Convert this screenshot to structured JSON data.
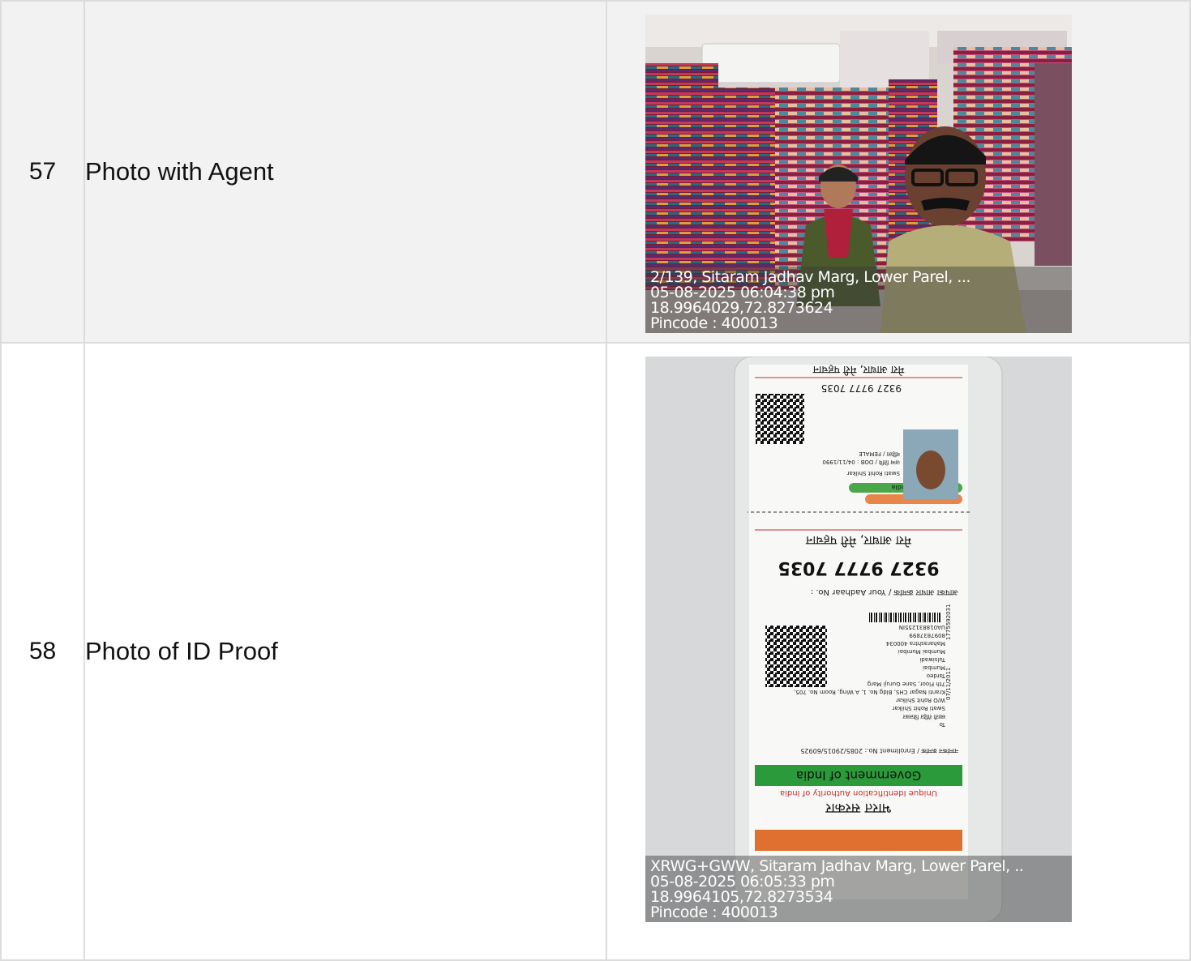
{
  "rows": [
    {
      "number": "57",
      "label": "Photo with Agent",
      "photo": {
        "subject": "selfie-in-textile-shop",
        "stamp": {
          "address": "2/139, Sitaram Jadhav Marg, Lower Parel, ...",
          "datetime": "05-08-2025 06:04:38 pm",
          "coords": "18.9964029,72.8273624",
          "pincode": "Pincode : 400013"
        }
      }
    },
    {
      "number": "58",
      "label": "Photo of ID Proof",
      "photo": {
        "subject": "aadhaar-card-in-plastic-sleeve",
        "card_text": {
          "tagline": "मेरा आधार, मेरी पहचान",
          "aadhaar_number": "9327 9777 7035",
          "aadhaar_label": "आपका आधार क्रमांक / Your Aadhaar No. :",
          "govt_hindi": "भारत सरकार",
          "govt_english": "Government of India",
          "uidai": "Unique Identification Authority of India",
          "name": "Swati Rohit Shilkar",
          "dob": "जन्म तिथि / DOB : 04/11/1990",
          "gender": "महिला / FEMALE",
          "enrollment": "नामांकन क्रमांक / Enrollment No.: 2085/29015/60925",
          "address_lines": [
            "To",
            "स्वाती रोहित शिलकर",
            "Swati Rohit Shilkar",
            "W/O Rohit Shilkar",
            "Kranti Nagar CHS, Bldg No. 1, A Wing, Room No. 705,",
            "7th Floor, Sane Guruji Marg",
            "Tardeo",
            "Mumbai",
            "Tulsiwadi",
            "Mumbai Mumbai",
            "Maharashtra 400034",
            "8097837899"
          ],
          "barcode_id": "UA018831255IN",
          "side_date": "07/11/2011",
          "side_number": "1775592031"
        },
        "stamp": {
          "address": "XRWG+GWW, Sitaram Jadhav Marg, Lower Parel, ..",
          "datetime": "05-08-2025 06:05:33 pm",
          "coords": "18.9964105,72.8273534",
          "pincode": "Pincode : 400013"
        }
      }
    }
  ]
}
